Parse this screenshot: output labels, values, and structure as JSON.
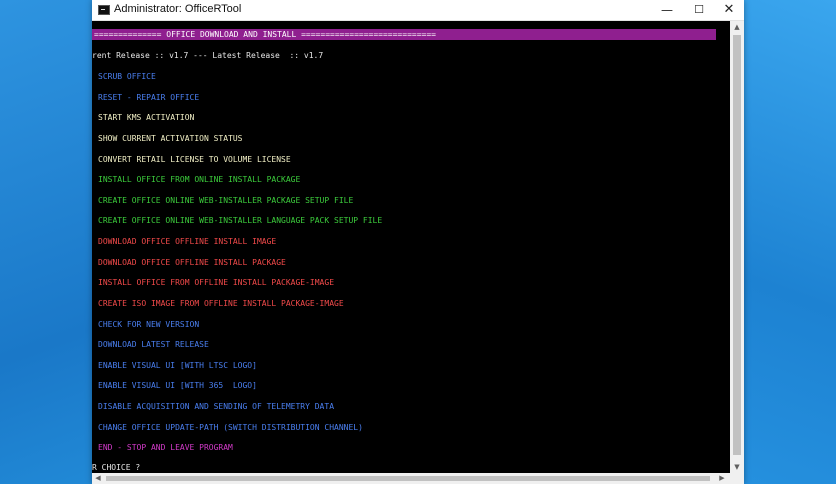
{
  "window": {
    "title": "Administrator:  OfficeRTool",
    "controls": {
      "minimize": "—",
      "maximize": "☐",
      "close": "✕"
    }
  },
  "console": {
    "header": "============== OFFICE DOWNLOAD AND INSTALL ============================",
    "release_line": "rent Release :: v1.7 --- Latest Release  :: v1.7",
    "options": [
      {
        "text": "SCRUB OFFICE",
        "color": "blue"
      },
      {
        "text": "RESET - REPAIR OFFICE",
        "color": "blue"
      },
      {
        "text": "START KMS ACTIVATION",
        "color": "cream"
      },
      {
        "text": "SHOW CURRENT ACTIVATION STATUS",
        "color": "cream"
      },
      {
        "text": "CONVERT RETAIL LICENSE TO VOLUME LICENSE",
        "color": "cream"
      },
      {
        "text": "INSTALL OFFICE FROM ONLINE INSTALL PACKAGE",
        "color": "green"
      },
      {
        "text": "CREATE OFFICE ONLINE WEB-INSTALLER PACKAGE SETUP FILE",
        "color": "green"
      },
      {
        "text": "CREATE OFFICE ONLINE WEB-INSTALLER LANGUAGE PACK SETUP FILE",
        "color": "green"
      },
      {
        "text": "DOWNLOAD OFFICE OFFLINE INSTALL IMAGE",
        "color": "red"
      },
      {
        "text": "DOWNLOAD OFFICE OFFLINE INSTALL PACKAGE",
        "color": "red"
      },
      {
        "text": "INSTALL OFFICE FROM OFFLINE INSTALL PACKAGE-IMAGE",
        "color": "red"
      },
      {
        "text": "CREATE ISO IMAGE FROM OFFLINE INSTALL PACKAGE-IMAGE",
        "color": "red"
      },
      {
        "text": "CHECK FOR NEW VERSION",
        "color": "blue"
      },
      {
        "text": "DOWNLOAD LATEST RELEASE",
        "color": "blue"
      },
      {
        "text": "ENABLE VISUAL UI [WITH LTSC LOGO]",
        "color": "blue"
      },
      {
        "text": "ENABLE VISUAL UI [WITH 365  LOGO]",
        "color": "blue"
      },
      {
        "text": "DISABLE ACQUISITION AND SENDING OF TELEMETRY DATA",
        "color": "blue"
      },
      {
        "text": "CHANGE OFFICE UPDATE-PATH (SWITCH DISTRIBUTION CHANNEL)",
        "color": "blue"
      },
      {
        "text": "END - STOP AND LEAVE PROGRAM",
        "color": "magenta"
      }
    ],
    "prompt": "R CHOICE ?",
    "colors": {
      "header_bg": "#8f1f8f",
      "blue": "#4a7ff0",
      "cream": "#f2f0c6",
      "green": "#3ccc3c",
      "red": "#f24a4a",
      "magenta": "#d23ac8"
    }
  }
}
